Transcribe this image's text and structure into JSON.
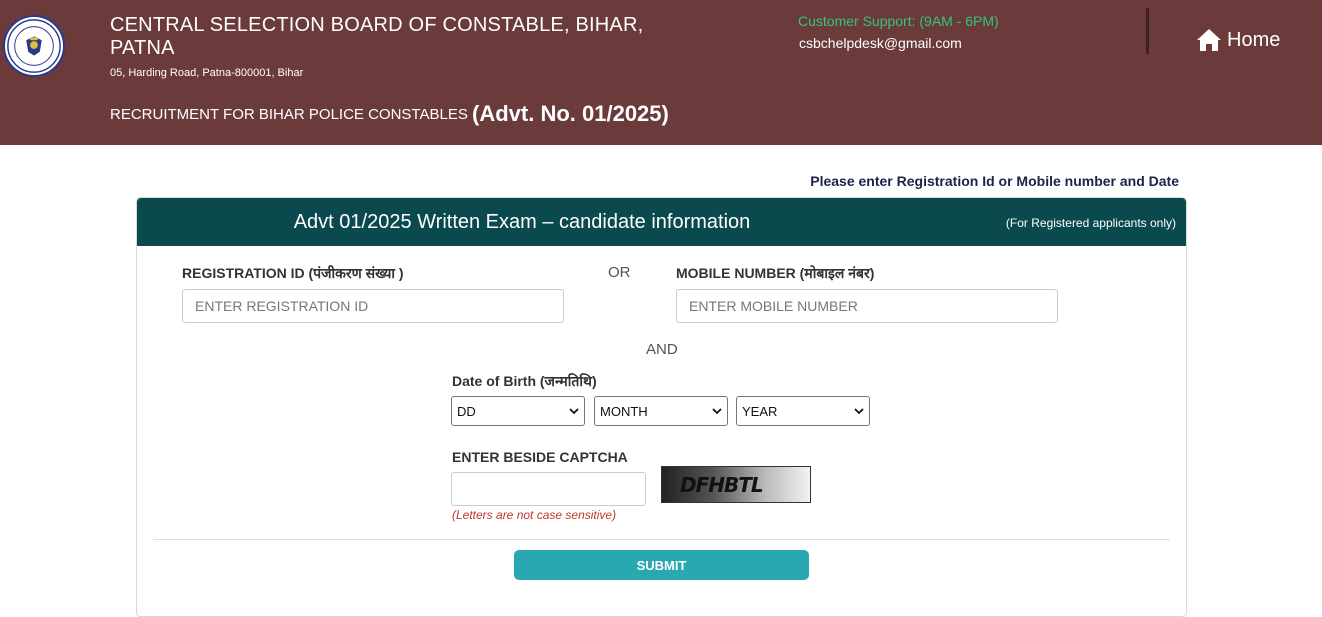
{
  "header": {
    "org_name": "CENTRAL SELECTION BOARD OF CONSTABLE, BIHAR, PATNA",
    "address": "05, Harding Road, Patna-800001, Bihar",
    "recruitment_text": "RECRUITMENT FOR BIHAR POLICE CONSTABLES",
    "advt_text": "(Advt. No. 01/2025)",
    "support_label": "Customer Support: (9AM - 6PM)",
    "support_email": "csbchelpdesk@gmail.com",
    "home_label": "Home"
  },
  "instruction": "Please enter Registration Id or Mobile number and Date",
  "panel": {
    "title": "Advt 01/2025 Written Exam – candidate information",
    "note": "(For Registered applicants only)"
  },
  "form": {
    "registration_label": "REGISTRATION ID (पंजीकरण संख्या )",
    "registration_placeholder": "ENTER REGISTRATION ID",
    "or_text": "OR",
    "mobile_label": "MOBILE NUMBER (मोबाइल नंबर)",
    "mobile_placeholder": "ENTER MOBILE NUMBER",
    "and_text": "AND",
    "dob_label": "Date of Birth (जन्मतिथि)",
    "day_selected": "DD",
    "month_selected": "MONTH",
    "year_selected": "YEAR",
    "captcha_label": "ENTER BESIDE CAPTCHA",
    "captcha_text": "DFHBTL",
    "captcha_hint": "(Letters are not case sensitive)",
    "submit_label": "SUBMIT"
  },
  "colors": {
    "header_bg": "#6b3a3a",
    "panel_head_bg": "#0a4a4f",
    "support_text": "#36c37a",
    "submit_bg": "#2aa8b2",
    "hint_text": "#c0392b"
  }
}
